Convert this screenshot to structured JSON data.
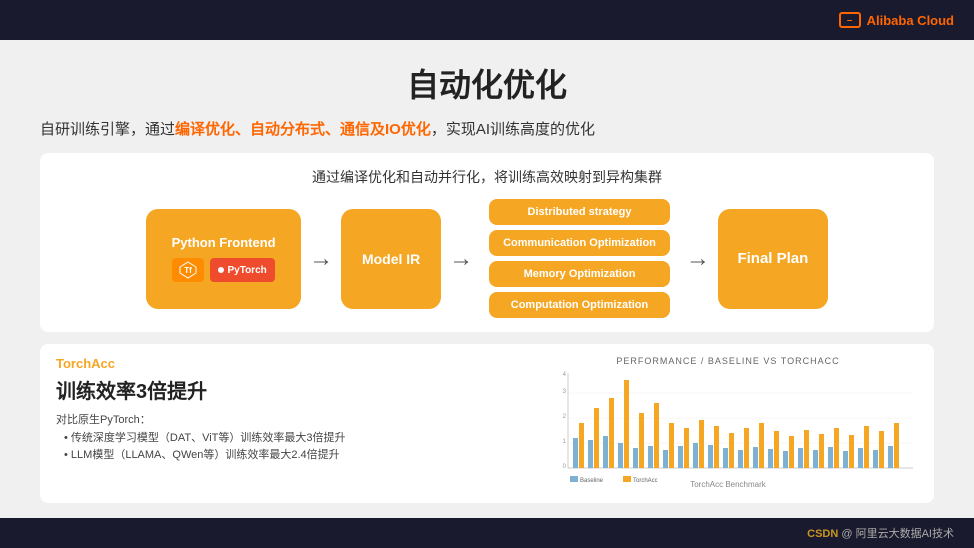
{
  "header": {
    "logo_text": "Alibaba Cloud"
  },
  "slide": {
    "title": "自动化优化",
    "subtitle_parts": [
      {
        "text": "自研训练引擎，通过",
        "highlight": false
      },
      {
        "text": "编译优化、自动分布式、通信及IO优化",
        "highlight": true
      },
      {
        "text": "，实现AI训练高度的优化",
        "highlight": false
      }
    ],
    "diagram": {
      "title": "通过编译优化和自动并行化，将训练高效映射到异构集群",
      "box1_title": "Python Frontend",
      "box1_tf": "Tf",
      "box1_pytorch": "PyTorch",
      "arrow1": "→",
      "box2_title": "Model IR",
      "arrow2": "→",
      "stack_items": [
        "Distributed strategy",
        "Communication Optimization",
        "Memory Optimization",
        "Computation Optimization"
      ],
      "arrow3": "→",
      "box3_title": "Final Plan"
    },
    "bottom": {
      "torchacc_label": "TorchAcc",
      "heading": "训练效率3倍提升",
      "desc_intro": "对比原生PyTorch：",
      "desc_items": [
        "传统深度学习模型（DAT、ViT等）训练效率最大3倍提升",
        "LLM模型（LLAMA、QWen等）训练效率最大2.4倍提升"
      ],
      "chart_title": "PERFORMANCE / BASELINE VS TORCHACC",
      "chart_sub": "TorchAcc Benchmark"
    }
  },
  "footer": {
    "csdn_text": "CSDN",
    "at": "@",
    "rest_text": "阿里云大数据AI技术"
  }
}
